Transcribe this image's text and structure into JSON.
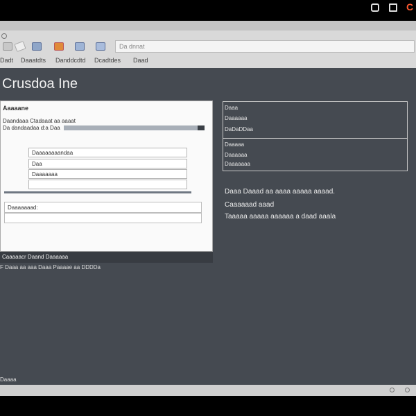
{
  "system_bar": {
    "icons": [
      "window-icon",
      "menu-icon",
      "app-c-icon"
    ],
    "app_glyph": "C"
  },
  "toolbar": {
    "icons": [
      "reload-icon",
      "crop-icon",
      "grid-icon",
      "flag-icon",
      "image-icon",
      "layout-icon"
    ],
    "address_placeholder": "Da dnnat"
  },
  "menu": {
    "items": [
      "Dadt",
      "Daaatdts",
      "Danddcdtd",
      "Dcadtdes",
      "Daad"
    ]
  },
  "page": {
    "title": "Crusdoa Ine"
  },
  "panel": {
    "header": "Aaaaane",
    "row1": "Daandaaa Ctadaaat aa aaaat",
    "row2": "Da dandaadaa d:a Daa",
    "progress_fraction": 0.95,
    "fields": [
      "Daaaaaaaandaa",
      "Daa",
      "Daaaaaaa"
    ],
    "comment_label": "Daaaaaaad:",
    "footer": "Caaaaacr Daand Daaaaaa",
    "below_footer": "F Daaa aa aaa Daaa Paaaae aa DDDDa"
  },
  "right": {
    "box1": [
      "Daaa",
      "Daaaaaa",
      "DaDaDDaa"
    ],
    "box2": [
      "Daaaaa",
      "Daaaaaa",
      "Daaaaaaa"
    ],
    "para1": "Daaa Daaad aa aaaa aaaaa aaaad.",
    "para2": "Caaaaaad aaad",
    "para3": "Taaaaa aaaaa aaaaaa a daad aaala"
  },
  "status": {
    "left_text": "Daaaa"
  }
}
